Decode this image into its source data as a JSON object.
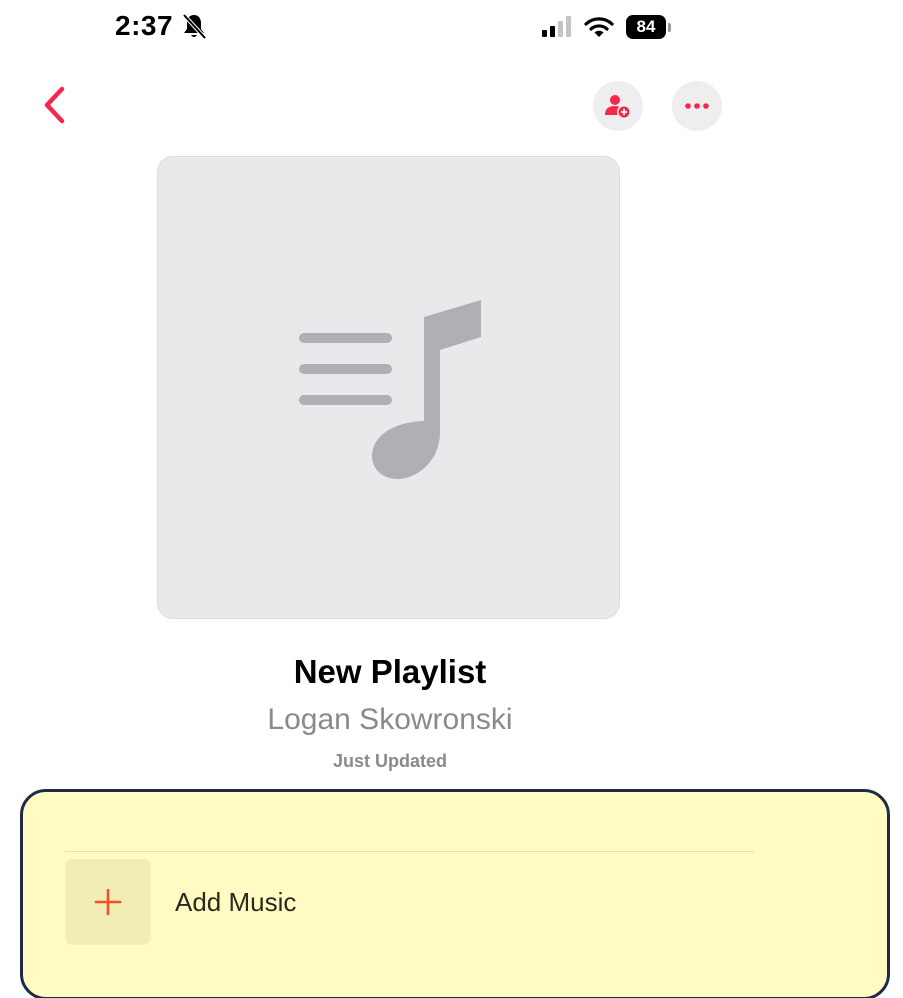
{
  "status_bar": {
    "time": "2:37",
    "battery": "84",
    "icons": [
      "bell-slash-icon",
      "signal-icon",
      "wifi-icon",
      "battery-icon"
    ]
  },
  "nav": {
    "icons": [
      "chevron-left-icon",
      "person-add-icon",
      "ellipsis-icon"
    ]
  },
  "artwork": {
    "icon": "music-note-list-icon"
  },
  "playlist": {
    "title": "New Playlist",
    "owner": "Logan Skowronski",
    "updated": "Just Updated"
  },
  "actions": {
    "add_music_label": "Add Music",
    "add_icon": "plus-icon"
  },
  "colors": {
    "accent": "#f5284b",
    "add_plus": "#f4502a",
    "secondary_text": "#8a8a8e",
    "artwork_bg": "#e9e9eb",
    "artwork_icon": "#b0b0b4",
    "highlight_bg": "#fffbc2",
    "highlight_border": "#1f2a44"
  }
}
